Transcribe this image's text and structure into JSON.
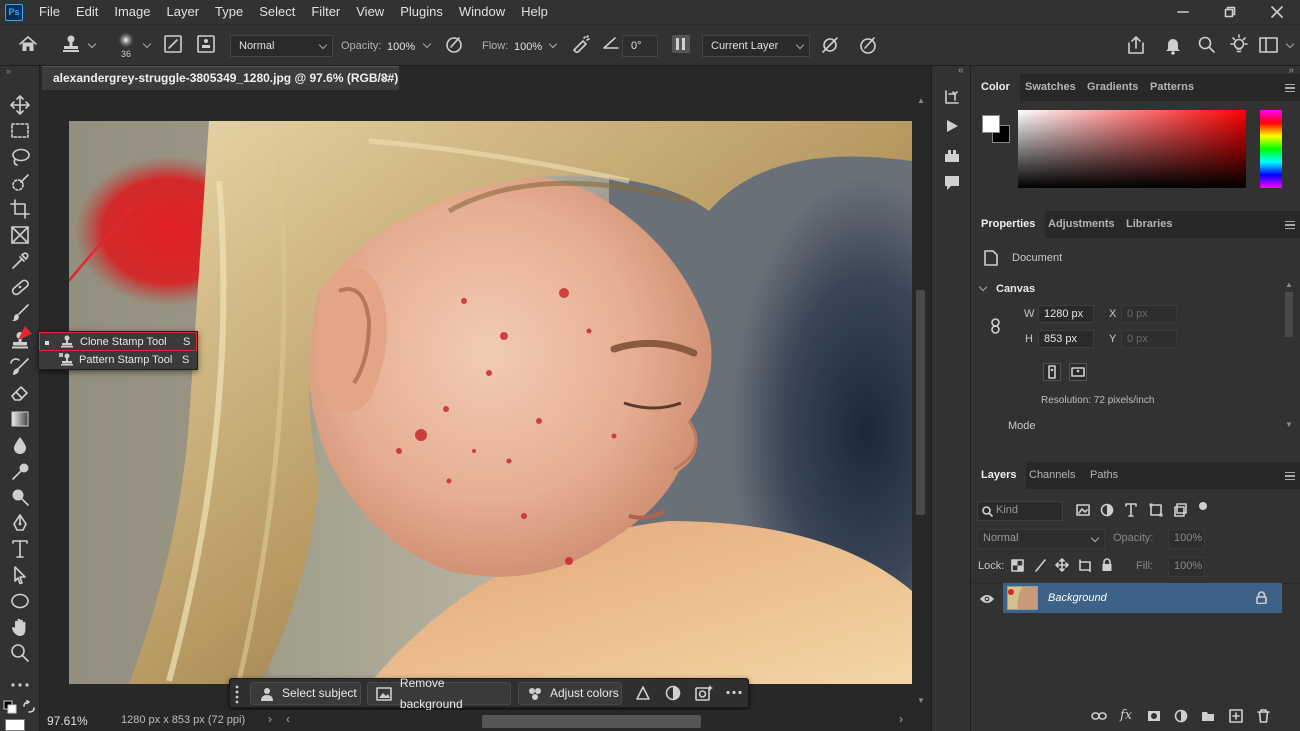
{
  "app": {
    "logo": "Ps",
    "name": "Photoshop"
  },
  "menu": [
    "File",
    "Edit",
    "Image",
    "Layer",
    "Type",
    "Select",
    "Filter",
    "View",
    "Plugins",
    "Window",
    "Help"
  ],
  "options": {
    "brush_size": "36",
    "mode": "Normal",
    "opacity_label": "Opacity:",
    "opacity_value": "100%",
    "flow_label": "Flow:",
    "flow_value": "100%",
    "angle_value": "0°",
    "sample": "Current Layer"
  },
  "document": {
    "tab_title": "alexandergrey-struggle-3805349_1280.jpg @ 97.6% (RGB/8#)",
    "close": "×"
  },
  "flyout": {
    "items": [
      {
        "label": "Clone Stamp Tool",
        "shortcut": "S",
        "selected": true,
        "icon": "stamp-icon"
      },
      {
        "label": "Pattern Stamp Tool",
        "shortcut": "S",
        "selected": false,
        "icon": "pattern-stamp-icon"
      }
    ]
  },
  "taskbar": {
    "select_subject": "Select subject",
    "remove_background": "Remove background",
    "adjust_colors": "Adjust colors"
  },
  "status": {
    "zoom": "97.61%",
    "info": "1280 px x 853 px (72 ppi)"
  },
  "color_panel": {
    "tabs": [
      "Color",
      "Swatches",
      "Gradients",
      "Patterns"
    ],
    "foreground": "#ffffff",
    "background": "#000000",
    "hue": "#ff0000"
  },
  "properties_panel": {
    "tabs": [
      "Properties",
      "Adjustments",
      "Libraries"
    ],
    "doc_label": "Document",
    "canvas_heading": "Canvas",
    "w_label": "W",
    "w_value": "1280 px",
    "h_label": "H",
    "h_value": "853 px",
    "x_label": "X",
    "x_value": "0 px",
    "y_label": "Y",
    "y_value": "0 px",
    "resolution": "Resolution: 72 pixels/inch",
    "mode_label": "Mode"
  },
  "layers_panel": {
    "tabs": [
      "Layers",
      "Channels",
      "Paths"
    ],
    "filter_placeholder": "Kind",
    "blend_mode": "Normal",
    "opacity_label": "Opacity:",
    "opacity_value": "100%",
    "lock_label": "Lock:",
    "fill_label": "Fill:",
    "fill_value": "100%",
    "layers": [
      {
        "name": "Background",
        "visible": true,
        "locked": true
      }
    ]
  },
  "colors": {
    "accent_red": "#e3262f",
    "layer_selected": "#3d6288"
  }
}
